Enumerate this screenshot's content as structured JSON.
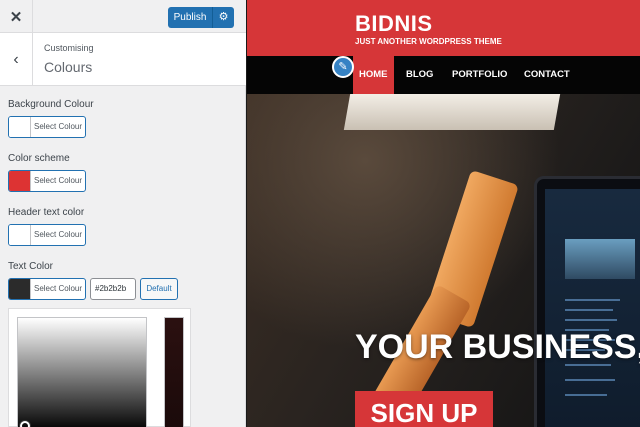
{
  "topbar": {
    "close_icon": "close-icon",
    "publish_label": "Publish",
    "gear_icon": "gear-icon"
  },
  "section": {
    "back_icon": "chevron-left-icon",
    "breadcrumb": "Customising",
    "title": "Colours"
  },
  "controls": [
    {
      "label": "Background Colour",
      "button": "Select Colour",
      "swatch": "#ffffff"
    },
    {
      "label": "Color scheme",
      "button": "Select Colour",
      "swatch": "#dd3333"
    },
    {
      "label": "Header text color",
      "button": "Select Colour",
      "swatch": "#ffffff"
    },
    {
      "label": "Text Color",
      "button": "Select Colour",
      "swatch": "#2b2b2b",
      "hex": "#2b2b2b",
      "default_label": "Default"
    }
  ],
  "preview": {
    "site_title": "BIDNIS",
    "site_tagline": "JUST ANOTHER WORDPRESS THEME",
    "nav": [
      "HOME",
      "BLOG",
      "PORTFOLIO",
      "CONTACT"
    ],
    "edit_icon": "pencil-icon",
    "hero_heading": "YOUR BUSINESS,",
    "hero_cta": "SIGN UP",
    "accent": "#d63638"
  }
}
